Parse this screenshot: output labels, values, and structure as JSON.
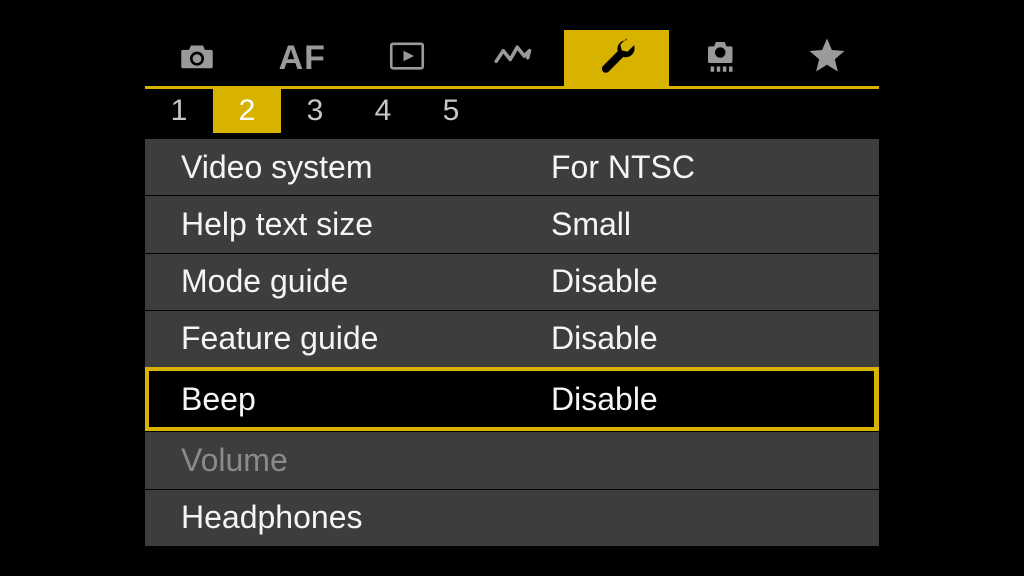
{
  "tabs": {
    "active_index": 4,
    "items": [
      {
        "name": "camera-icon"
      },
      {
        "name": "af-icon",
        "label": "AF"
      },
      {
        "name": "play-icon"
      },
      {
        "name": "wireless-icon"
      },
      {
        "name": "wrench-icon"
      },
      {
        "name": "custom-icon"
      },
      {
        "name": "star-icon"
      }
    ]
  },
  "subtabs": {
    "active_index": 1,
    "items": [
      "1",
      "2",
      "3",
      "4",
      "5"
    ]
  },
  "rows": [
    {
      "label": "Video system",
      "value": "For NTSC",
      "state": "normal"
    },
    {
      "label": "Help text size",
      "value": "Small",
      "state": "normal"
    },
    {
      "label": "Mode guide",
      "value": "Disable",
      "state": "normal"
    },
    {
      "label": "Feature guide",
      "value": "Disable",
      "state": "normal"
    },
    {
      "label": "Beep",
      "value": "Disable",
      "state": "selected"
    },
    {
      "label": "Volume",
      "value": "",
      "state": "disabled"
    },
    {
      "label": "Headphones",
      "value": "",
      "state": "normal"
    }
  ],
  "colors": {
    "accent": "#d7b300",
    "row_bg": "#3d3d3d"
  }
}
